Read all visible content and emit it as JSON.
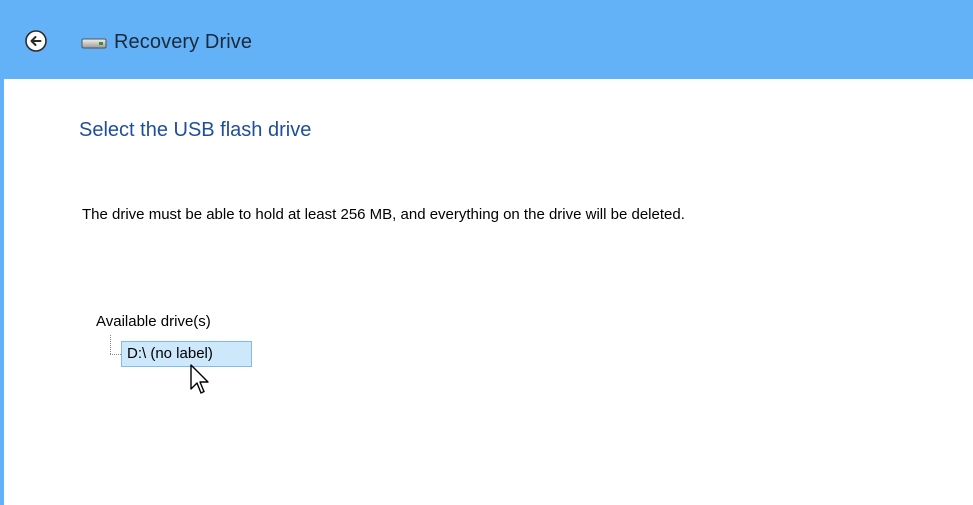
{
  "window": {
    "title": "Recovery Drive",
    "accent_color": "#63b1f7"
  },
  "icons": {
    "back": "back-arrow-icon",
    "drive": "drive-icon",
    "cursor": "mouse-pointer-icon"
  },
  "page": {
    "heading": "Select the USB flash drive",
    "description": "The drive must be able to hold at least 256 MB, and everything on the drive will be deleted."
  },
  "drives": {
    "label": "Available drive(s)",
    "items": [
      {
        "name": "D:\\ (no label)",
        "selected": true
      }
    ]
  }
}
